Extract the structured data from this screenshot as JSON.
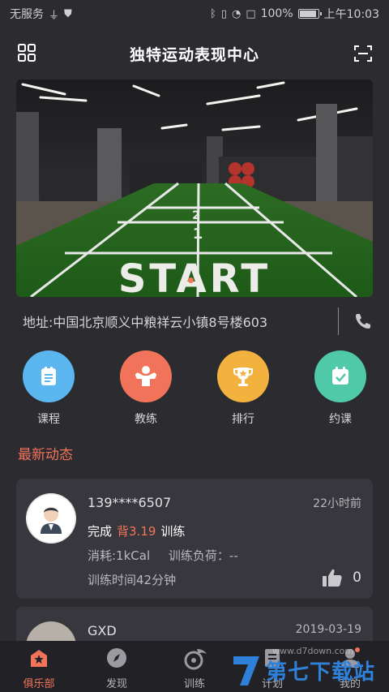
{
  "status_bar": {
    "carrier": "无服务",
    "battery": "100%",
    "time": "上午10:03"
  },
  "header": {
    "title": "独特运动表现中心"
  },
  "banner": {
    "floor_text": "START",
    "lane_number": "1",
    "lane_number_2": "2"
  },
  "club": {
    "address": "地址:中国北京顺义中粮祥云小镇8号楼603"
  },
  "shortcuts": [
    {
      "label": "课程",
      "icon": "course-icon",
      "color": "#5bb5ee"
    },
    {
      "label": "教练",
      "icon": "coach-icon",
      "color": "#f0735a"
    },
    {
      "label": "排行",
      "icon": "trophy-icon",
      "color": "#f3b23e"
    },
    {
      "label": "约课",
      "icon": "calendar-check-icon",
      "color": "#4fc9a8"
    }
  ],
  "feed": {
    "section_title": "最新动态",
    "items": [
      {
        "user": "139****6507",
        "time": "22小时前",
        "done_prefix": "完成",
        "done_highlight": "背3.19",
        "done_suffix": "训练",
        "calories": "消耗:1kCal",
        "load": "训练负荷：--",
        "duration": "训练时间42分钟",
        "likes": "0"
      },
      {
        "user": "GXD",
        "time": "2019-03-19"
      }
    ]
  },
  "tabbar": {
    "items": [
      {
        "label": "俱乐部",
        "active": true
      },
      {
        "label": "发现",
        "active": false
      },
      {
        "label": "训练",
        "active": false
      },
      {
        "label": "计划",
        "active": false
      },
      {
        "label": "我的",
        "active": false
      }
    ]
  },
  "watermark": {
    "brand": "第七下载站",
    "url": "www.d7down.com"
  },
  "colors": {
    "accent": "#f0735a",
    "background": "#2b2b30",
    "card": "#37373d"
  }
}
